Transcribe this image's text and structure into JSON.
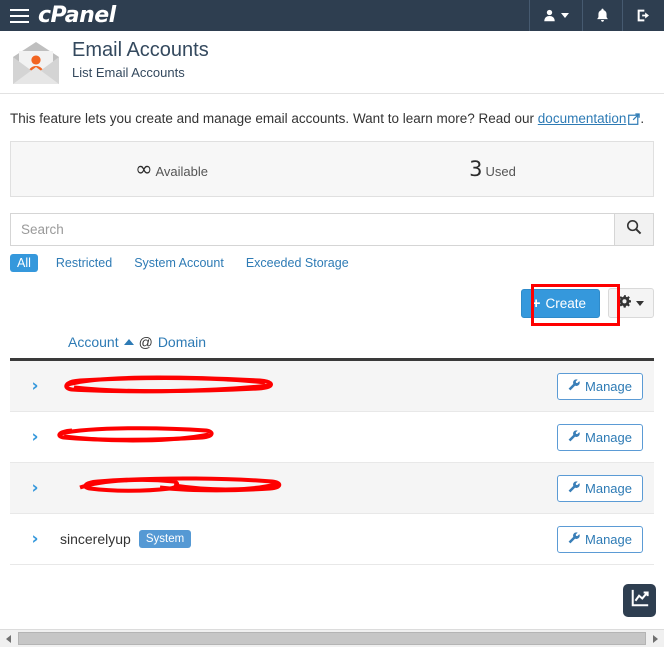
{
  "topbar": {
    "brand": "cPanel",
    "menu_icon": "hamburger-icon",
    "user_icon": "user-icon",
    "notifications_icon": "bell-icon",
    "logout_icon": "logout-icon"
  },
  "header": {
    "title": "Email Accounts",
    "subtitle": "List Email Accounts",
    "icon": "email-account-envelope-icon"
  },
  "description": {
    "text_before": "This feature lets you create and manage email accounts. Want to learn more? Read our",
    "link_label": "documentation",
    "text_after": "."
  },
  "stats": [
    {
      "value": "∞",
      "label": "Available"
    },
    {
      "value": "3",
      "label": "Used"
    }
  ],
  "search": {
    "placeholder": "Search",
    "value": "",
    "button_icon": "search-icon"
  },
  "filters": [
    {
      "label": "All",
      "active": true
    },
    {
      "label": "Restricted",
      "active": false
    },
    {
      "label": "System Account",
      "active": false
    },
    {
      "label": "Exceeded Storage",
      "active": false
    }
  ],
  "actions": {
    "create_label": "Create",
    "create_plus": "+",
    "settings_icon": "gear-icon",
    "highlight_color": "#fe0000"
  },
  "table": {
    "header": {
      "account_label": "Account",
      "sort_direction": "ascending",
      "at_symbol": "@",
      "domain_label": "Domain"
    },
    "rows": [
      {
        "account": "",
        "redacted": true,
        "badge": "",
        "manage_label": "Manage"
      },
      {
        "account": "",
        "redacted": true,
        "badge": "",
        "manage_label": "Manage"
      },
      {
        "account": "",
        "redacted": true,
        "badge": "",
        "manage_label": "Manage"
      },
      {
        "account": "sincerelyup",
        "redacted": false,
        "badge": "System",
        "manage_label": "Manage"
      }
    ]
  },
  "float_widget": {
    "icon": "analytics-chart-icon"
  },
  "colors": {
    "header_bg": "#2e3e50",
    "primary_blue": "#3598dc",
    "link_blue": "#2e7bb5",
    "annotation_red": "#fe0000"
  }
}
